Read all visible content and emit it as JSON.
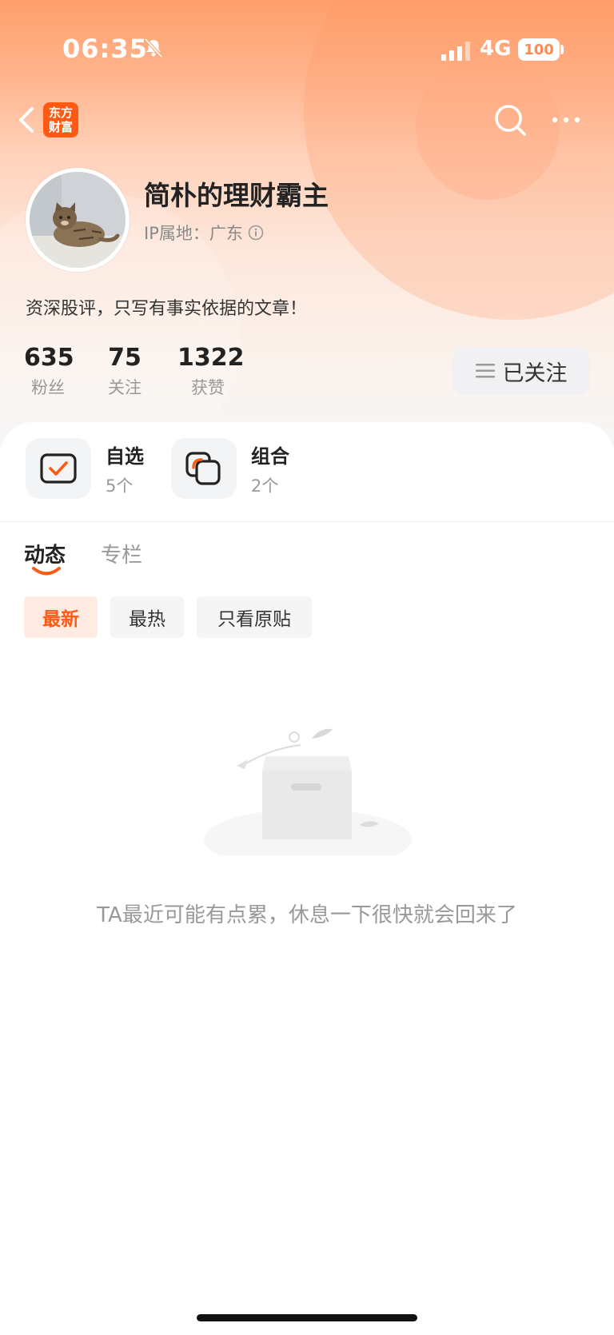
{
  "status_bar": {
    "time": "06:35",
    "network": "4G",
    "battery": "100"
  },
  "app": {
    "logo_text_line1": "东方",
    "logo_text_line2": "财富"
  },
  "profile": {
    "username": "简朴的理财霸主",
    "ip_location": "IP属地：广东",
    "bio": "资深股评，只写有事实依据的文章！"
  },
  "stats": [
    {
      "value": "635",
      "label": "粉丝"
    },
    {
      "value": "75",
      "label": "关注"
    },
    {
      "value": "1322",
      "label": "获赞"
    }
  ],
  "follow_button": {
    "label": "已关注"
  },
  "features": [
    {
      "title": "自选",
      "count": "5个",
      "icon": "check-icon"
    },
    {
      "title": "组合",
      "count": "2个",
      "icon": "portfolio-icon"
    }
  ],
  "tabs": [
    {
      "label": "动态",
      "active": true
    },
    {
      "label": "专栏",
      "active": false
    }
  ],
  "filters": [
    {
      "label": "最新",
      "active": true
    },
    {
      "label": "最热",
      "active": false
    },
    {
      "label": "只看原贴",
      "active": false
    }
  ],
  "empty_state": {
    "message": "TA最近可能有点累，休息一下很快就会回来了"
  },
  "colors": {
    "accent": "#ff5a14",
    "header_gradient_top": "#ff9f6a"
  }
}
